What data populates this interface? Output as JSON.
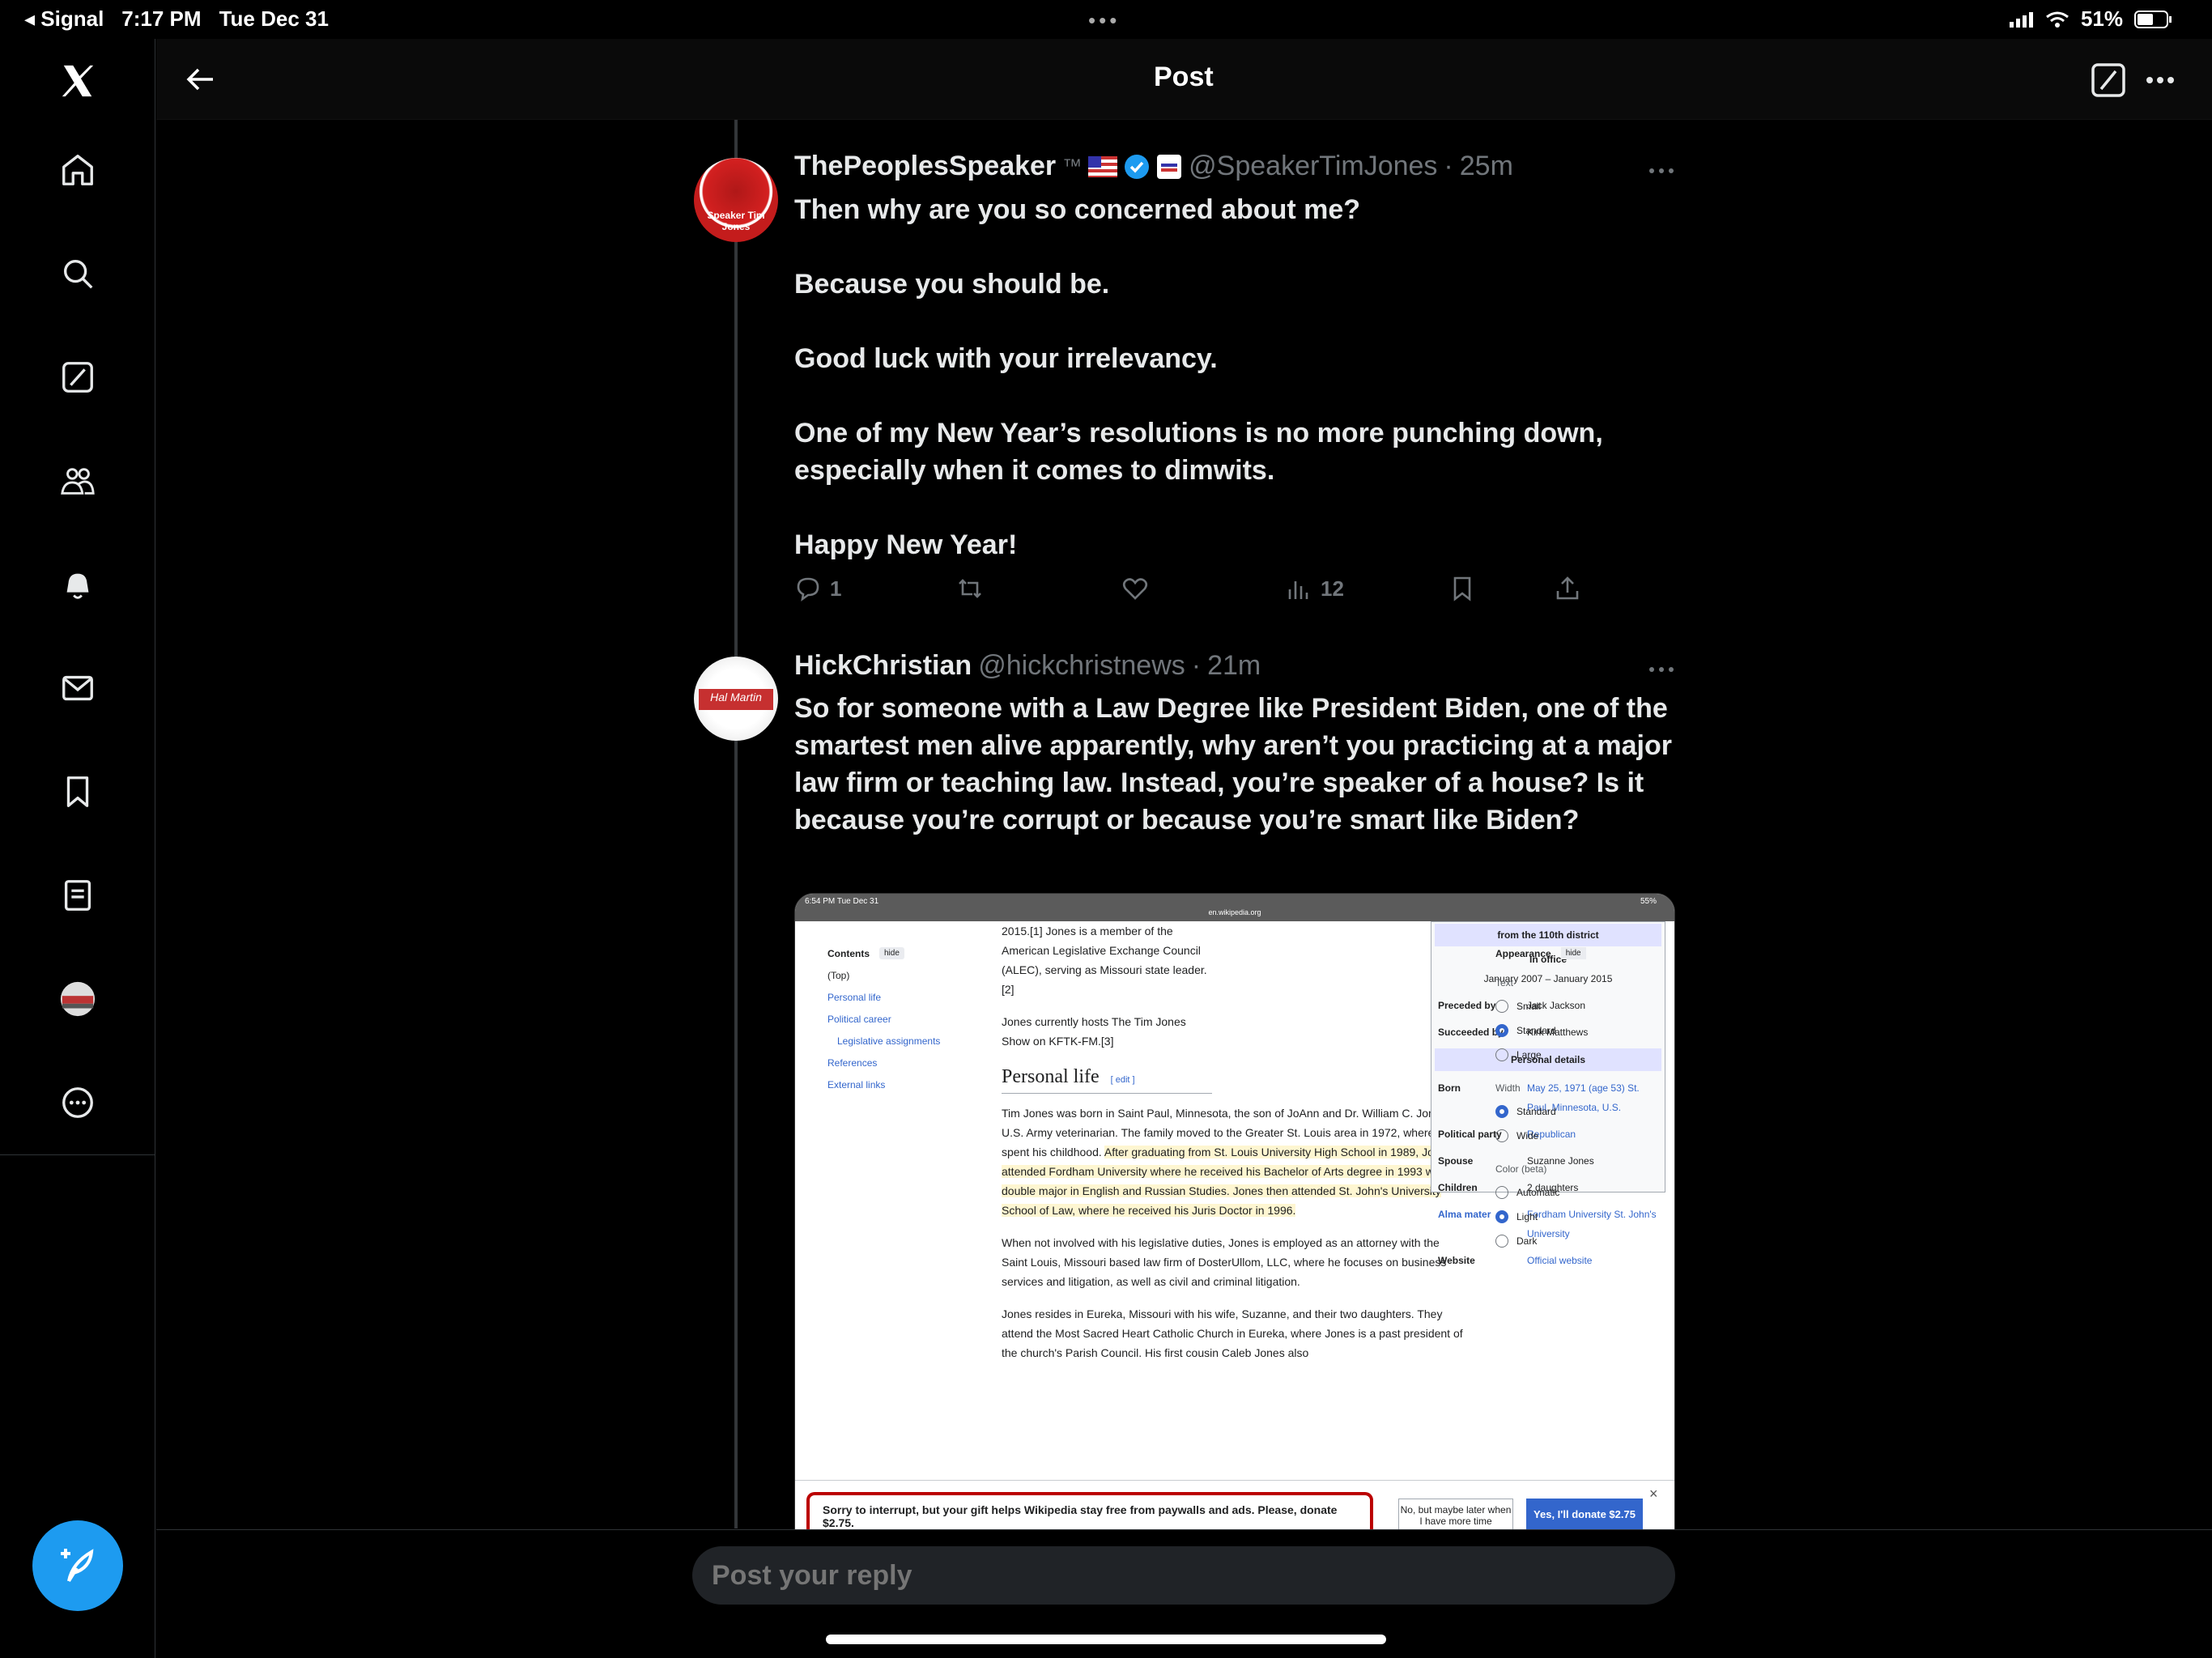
{
  "status_bar": {
    "back_app": "◂ Signal",
    "time": "7:17 PM",
    "date": "Tue Dec 31",
    "dots": "•••",
    "battery": "51%"
  },
  "header": {
    "title": "Post"
  },
  "sidebar": {
    "items": [
      {
        "icon": "x-logo-icon"
      },
      {
        "icon": "home-icon"
      },
      {
        "icon": "search-icon"
      },
      {
        "icon": "grok-icon"
      },
      {
        "icon": "communities-icon"
      },
      {
        "icon": "notifications-icon"
      },
      {
        "icon": "messages-icon"
      },
      {
        "icon": "bookmarks-icon"
      },
      {
        "icon": "lists-icon"
      },
      {
        "icon": "profile-avatar"
      },
      {
        "icon": "more-icon"
      }
    ]
  },
  "tweets": [
    {
      "name": "ThePeoplesSpeaker",
      "tm": "™",
      "handle": "@SpeakerTimJones",
      "dot": "·",
      "time": "25m",
      "avatar_text": "Speaker Tim Jones",
      "body": [
        "Then why are you so concerned about me?",
        "Because you should be.",
        "Good luck with your irrelevancy.",
        "One of my New Year’s resolutions is no more punching down, especially when it comes to dimwits.",
        "Happy New Year!"
      ],
      "replies": "1",
      "views": "12"
    },
    {
      "name": "HickChristian",
      "handle": "@hickchristnews",
      "dot": "·",
      "time": "21m",
      "avatar_text": "Hal Martin",
      "body": "So for someone with a Law Degree like President Biden, one of the smartest men alive apparently, why aren’t you practicing at a major law firm or teaching law. Instead, you’re speaker of a house? Is it because you’re corrupt or because you’re smart like Biden?"
    }
  ],
  "embed": {
    "status_time": "6:54 PM  Tue Dec 31",
    "status_url": "en.wikipedia.org",
    "status_right": "55%",
    "toc": {
      "title": "Contents",
      "hide": "hide",
      "items": [
        "(Top)",
        "Personal life",
        "Political career",
        "Legislative assignments",
        "References",
        "External links"
      ]
    },
    "main": {
      "p1": "2015.[1] Jones is a member of the American Legislative Exchange Council (ALEC), serving as Missouri state leader.[2]",
      "p2": "Jones currently hosts The Tim Jones Show on KFTK-FM.[3]",
      "heading": "Personal life",
      "edit": "[ edit ]",
      "p3a": "Tim Jones was born in Saint Paul, Minnesota, the son of JoAnn and Dr. William C. Jones, a U.S. Army veterinarian. The family moved to the Greater St. Louis area in 1972, where Tim spent his childhood. ",
      "p3b": "After graduating from St. Louis University High School in 1989, Jones attended Fordham University where he received his Bachelor of Arts degree in 1993 with a double major in English and Russian Studies. Jones then attended St. John's University School of Law, where he received his Juris Doctor in 1996.",
      "p4": "When not involved with his legislative duties, Jones is employed as an attorney with the Saint Louis, Missouri based law firm of DosterUllom, LLC, where he focuses on business services and litigation, as well as civil and criminal litigation.",
      "p5": "Jones resides in Eureka, Missouri with his wife, Suzanne, and their two daughters. They attend the Most Sacred Heart Catholic Church in Eureka, where Jones is a past president of the church's Parish Council. His first cousin Caleb Jones also"
    },
    "infobox": {
      "district": "from the 110th district",
      "in_office": "In office",
      "term": "January 2007 – January 2015",
      "rows1": [
        {
          "k": "Preceded by",
          "v": "Jack Jackson"
        },
        {
          "k": "Succeeded by",
          "v": "Kirk Matthews"
        }
      ],
      "personal": "Personal details",
      "rows2": [
        {
          "k": "Born",
          "v": "May 25, 1971 (age 53) St. Paul, Minnesota, U.S."
        },
        {
          "k": "Political party",
          "v": "Republican"
        },
        {
          "k": "Spouse",
          "v": "Suzanne Jones"
        },
        {
          "k": "Children",
          "v": "2 daughters"
        },
        {
          "k": "Alma mater",
          "v": "Fordham University St. John's University"
        },
        {
          "k": "Website",
          "v": "Official website"
        }
      ]
    },
    "appearance": {
      "title": "Appearance",
      "hide": "hide",
      "text_label": "Text",
      "text_options": [
        "Small",
        "Standard",
        "Large"
      ],
      "width_label": "Width",
      "width_options": [
        "Standard",
        "Wide"
      ],
      "color_label": "Color (beta)",
      "color_options": [
        "Automatic",
        "Light",
        "Dark"
      ]
    },
    "donate": {
      "message": "Sorry to interrupt, but your gift helps Wikipedia stay free from paywalls and ads. Please, donate $2.75.",
      "no": "No, but maybe later when I have more time",
      "yes": "Yes, I'll donate $2.75",
      "close": "×"
    }
  },
  "reply": {
    "placeholder": "Post your reply"
  },
  "colors": {
    "accent": "#1d9bf0",
    "background": "#000000"
  }
}
